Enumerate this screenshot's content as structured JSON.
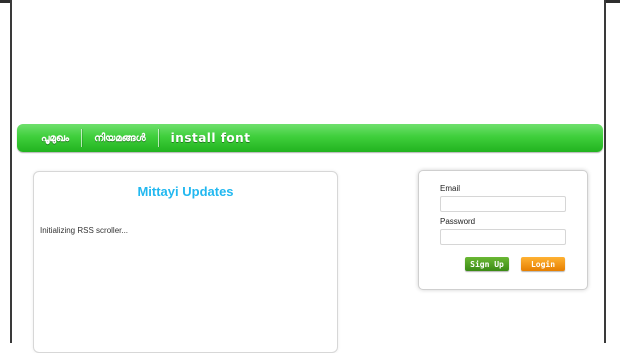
{
  "nav": {
    "items": [
      {
        "label": "പൂമുഖം"
      },
      {
        "label": "നിയമങ്ങൾ"
      },
      {
        "label": "install font"
      }
    ]
  },
  "updates": {
    "title": "Mittayi Updates",
    "status": "Initializing RSS scroller..."
  },
  "login": {
    "email_label": "Email",
    "password_label": "Password",
    "email_value": "",
    "password_value": "",
    "signup_label": "Sign Up",
    "login_label": "Login"
  },
  "colors": {
    "nav_green": "#3fcf3c",
    "title_blue": "#22b8f0",
    "signup_green": "#4a9a20",
    "login_orange": "#f08c00"
  }
}
